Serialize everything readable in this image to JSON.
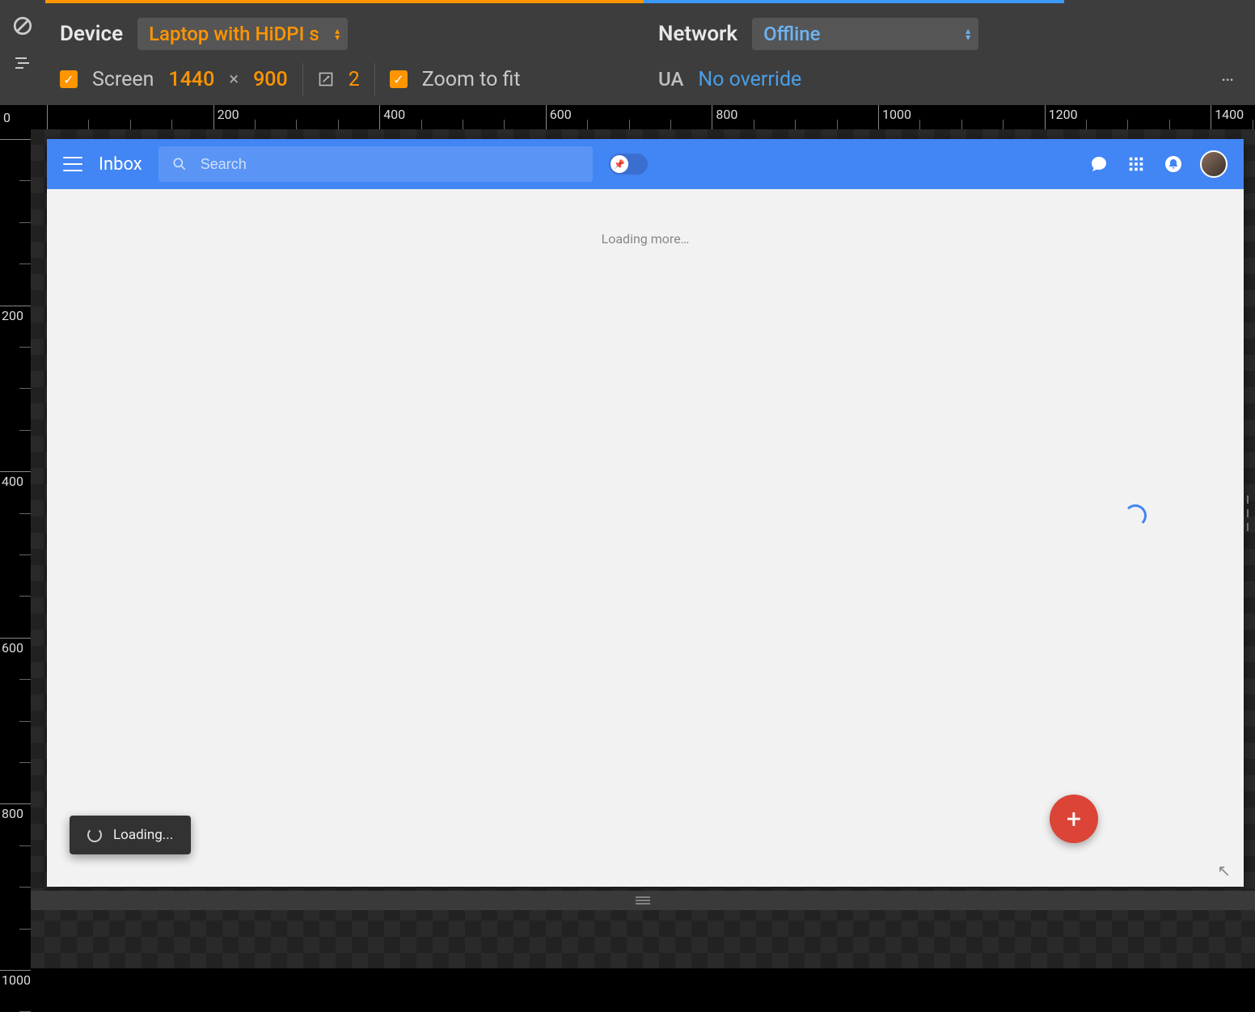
{
  "devtools": {
    "device_label": "Device",
    "device_value": "Laptop with HiDPI s",
    "network_label": "Network",
    "network_value": "Offline",
    "screen_label": "Screen",
    "width": "1440",
    "height": "900",
    "dpr": "2",
    "zoom_label": "Zoom to fit",
    "ua_label": "UA",
    "ua_value": "No override"
  },
  "ruler": {
    "h_marks": [
      "0",
      "200",
      "400",
      "600",
      "800",
      "1000",
      "1200",
      "1400"
    ],
    "v_marks": [
      "0",
      "200",
      "400",
      "600",
      "800",
      "1000"
    ]
  },
  "inbox": {
    "title": "Inbox",
    "search_placeholder": "Search",
    "loading_more": "Loading more…",
    "toast": "Loading..."
  }
}
